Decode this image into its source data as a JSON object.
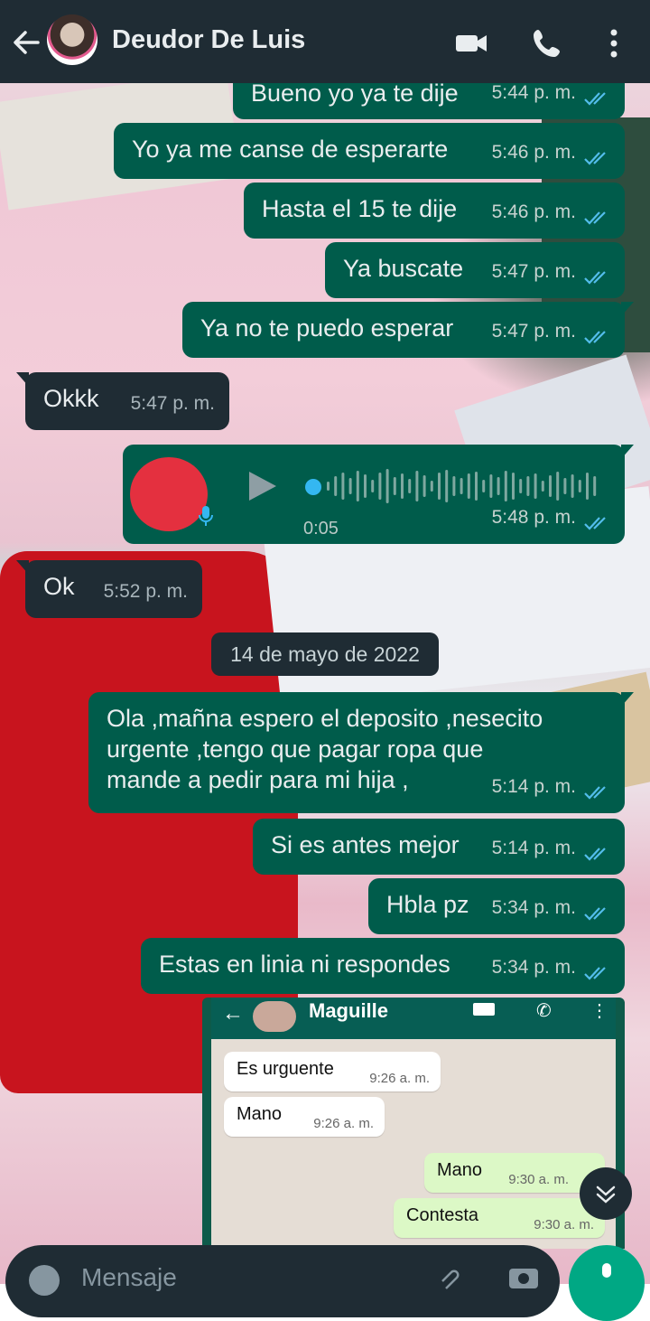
{
  "header": {
    "contact_name": "Deudor De Luis",
    "back_icon": "arrow-left-icon",
    "video_icon": "video-call-icon",
    "call_icon": "phone-icon",
    "menu_icon": "more-vertical-icon"
  },
  "colors": {
    "header_bg": "#1f2c34",
    "outgoing_bubble": "#005c4b",
    "incoming_bubble": "#1f2c34",
    "read_ticks": "#53bdeb",
    "accent": "#00a884"
  },
  "messages": [
    {
      "dir": "out",
      "text": "Bueno yo ya te dije",
      "time": "5:44 p. m."
    },
    {
      "dir": "out",
      "text": "Yo ya me canse de esperarte",
      "time": "5:46 p. m."
    },
    {
      "dir": "out",
      "text": "Hasta el 15 te dije",
      "time": "5:46 p. m."
    },
    {
      "dir": "out",
      "text": "Ya buscate",
      "time": "5:47 p. m."
    },
    {
      "dir": "out",
      "text": "Ya no te puedo esperar",
      "time": "5:47 p. m."
    },
    {
      "dir": "in",
      "text": "Okkk",
      "time": "5:47 p. m."
    },
    {
      "dir": "out",
      "type": "voice",
      "duration": "0:05",
      "time": "5:48 p. m.",
      "played_fraction": 0.0
    },
    {
      "dir": "in",
      "text": "Ok",
      "time": "5:52 p. m."
    },
    {
      "dir": "out",
      "text": "Ola ,mañna espero el deposito ,nesecito\nurgente ,tengo que pagar ropa que\nmande a pedir para mi hija ,",
      "time": "5:14 p. m."
    },
    {
      "dir": "out",
      "text": "Si es antes mejor",
      "time": "5:14 p. m."
    },
    {
      "dir": "out",
      "text": "Hbla pz",
      "time": "5:34 p. m."
    },
    {
      "dir": "out",
      "text": "Estas en linia ni respondes",
      "time": "5:34 p. m."
    }
  ],
  "date_separator": "14 de mayo de 2022",
  "embedded_screenshot": {
    "contact_name": "Maguille",
    "messages": [
      {
        "dir": "in",
        "text": "Es urguente",
        "time": "9:26 a. m."
      },
      {
        "dir": "in",
        "text": "Mano",
        "time": "9:26 a. m."
      },
      {
        "dir": "out",
        "text": "Mano",
        "time": "9:30 a. m."
      },
      {
        "dir": "out",
        "text": "Contesta",
        "time": "9:30 a. m."
      }
    ]
  },
  "composer": {
    "placeholder": "Mensaje",
    "emoji_icon": "emoji-icon",
    "attach_icon": "paperclip-icon",
    "camera_icon": "camera-icon",
    "mic_icon": "mic-icon"
  },
  "scroll_button_icon": "chevron-double-down-icon"
}
